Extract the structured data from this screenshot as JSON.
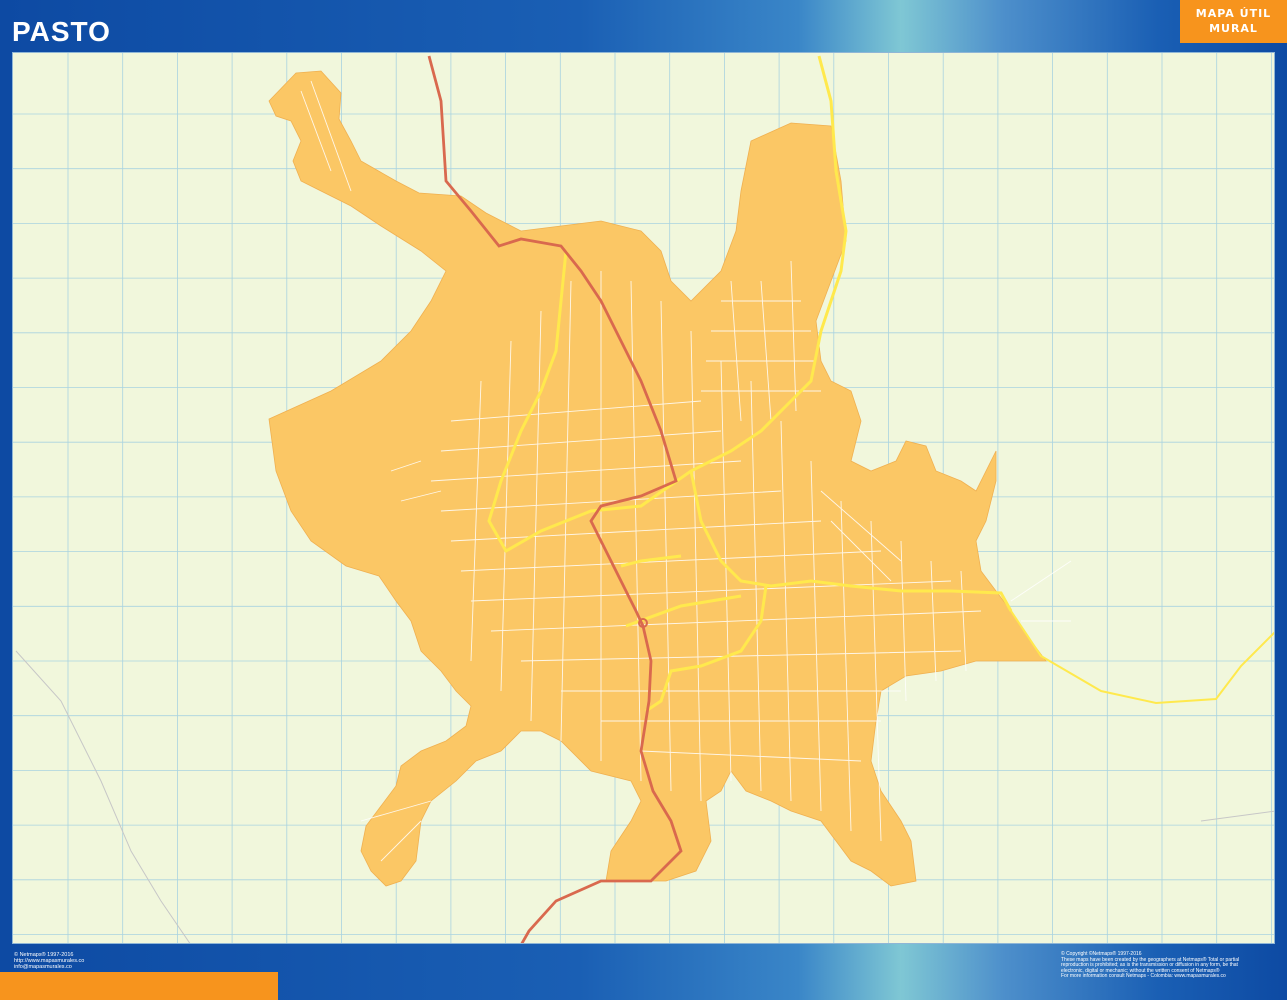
{
  "header": {
    "title": "PASTO",
    "brand_line1": "MAPA ÚTIL",
    "brand_line2": "MURAL"
  },
  "footer_left": {
    "line1": "© Netmaps® 1997-2016",
    "line2": "http://www.mapasmurales.co",
    "line3": "info@mapasmurales.co"
  },
  "footer_right": {
    "line1": "© Copyright ©Netmaps® 1997-2016",
    "line2": "These maps have been created by the geographers at Netmaps® Total or partial",
    "line3": "reproduction is prohibited; as is the transmission or diffusion in any form, be that",
    "line4": "electronic, digital or mechanic; without the written consent of Netmaps®",
    "line5": "For more information consult Netmaps - Colombia: www.mapasmurales.co"
  },
  "colors": {
    "header_blue": "#0d4aa3",
    "brand_orange": "#f7941d",
    "map_background": "#f1f7dc",
    "urban_area": "#fbc765",
    "main_road": "#d9694e",
    "highway": "#ffe94d",
    "grid": "#a9d3e0"
  }
}
